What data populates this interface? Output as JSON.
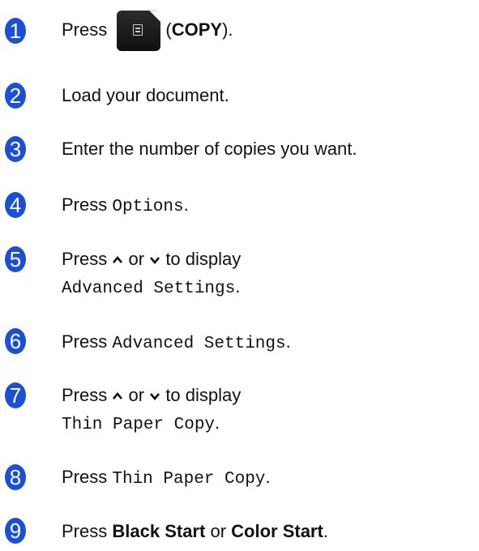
{
  "steps": [
    {
      "number": "1",
      "press": "Press",
      "paren_open": "(",
      "copy_label": "COPY",
      "paren_close": ").",
      "button_icon": "copy-icon"
    },
    {
      "number": "2",
      "text": "Load your document."
    },
    {
      "number": "3",
      "text": "Enter the number of copies you want."
    },
    {
      "number": "4",
      "press": "Press",
      "code": "Options",
      "period": "."
    },
    {
      "number": "5",
      "line1": "Press",
      "or": "or",
      "to_display": "to display",
      "code": "Advanced Settings",
      "period": ".",
      "up_icon": "chevron-up-icon",
      "down_icon": "chevron-down-icon"
    },
    {
      "number": "6",
      "press": "Press",
      "code": "Advanced Settings",
      "period": "."
    },
    {
      "number": "7",
      "line1": "Press",
      "or": "or",
      "to_display": "to display",
      "code": "Thin Paper Copy",
      "period": ".",
      "up_icon": "chevron-up-icon",
      "down_icon": "chevron-down-icon"
    },
    {
      "number": "8",
      "press": "Press",
      "code": "Thin Paper Copy",
      "period": "."
    },
    {
      "number": "9",
      "press": "Press",
      "black_start": "Black Start",
      "or": "or",
      "color_start": "Color Start",
      "period": "."
    }
  ],
  "colors": {
    "badge": "#1a4fd6"
  }
}
